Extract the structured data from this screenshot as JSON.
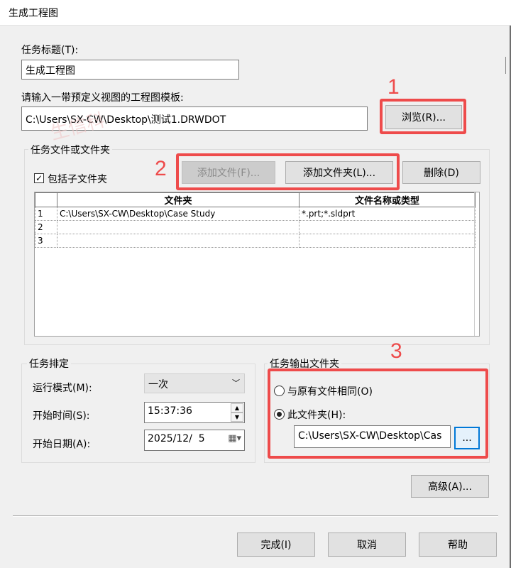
{
  "window": {
    "title": "生成工程图"
  },
  "task_title": {
    "label": "任务标题(T):",
    "value": "生成工程图"
  },
  "template": {
    "label": "请输入一带预定义视图的工程图模板:",
    "path": "C:\\Users\\SX-CW\\Desktop\\测试1.DRWDOT",
    "browse_label": "浏览(R)..."
  },
  "files_group": {
    "title": "任务文件或文件夹",
    "include_subfolders_label": "包括子文件夹",
    "include_subfolders_checked": true,
    "add_file_label": "添加文件(F)...",
    "add_folder_label": "添加文件夹(L)...",
    "delete_label": "删除(D)",
    "columns": [
      "文件夹",
      "文件名称或类型"
    ],
    "rows": [
      {
        "num": "1",
        "folder": "C:\\Users\\SX-CW\\Desktop\\Case Study",
        "type": "*.prt;*.sldprt"
      },
      {
        "num": "2",
        "folder": "",
        "type": ""
      },
      {
        "num": "3",
        "folder": "",
        "type": ""
      }
    ]
  },
  "schedule": {
    "title": "任务排定",
    "run_mode_label": "运行模式(M):",
    "run_mode_value": "一次",
    "start_time_label": "开始时间(S):",
    "start_time_value": "15:37:36",
    "start_date_label": "开始日期(A):",
    "start_date_value": "2025/12/  5"
  },
  "output": {
    "title": "任务输出文件夹",
    "same_as_original_label": "与原有文件相同(O)",
    "this_folder_label": "此文件夹(H):",
    "selected": "this_folder",
    "folder_path": "C:\\Users\\SX-CW\\Desktop\\Cas",
    "browse_label": "..."
  },
  "advanced_label": "高级(A)...",
  "footer": {
    "finish_label": "完成(I)",
    "cancel_label": "取消",
    "help_label": "帮助"
  },
  "annotations": [
    "1",
    "2",
    "3"
  ],
  "accent_color": "#ee4b4b",
  "focus_color": "#0078d7"
}
